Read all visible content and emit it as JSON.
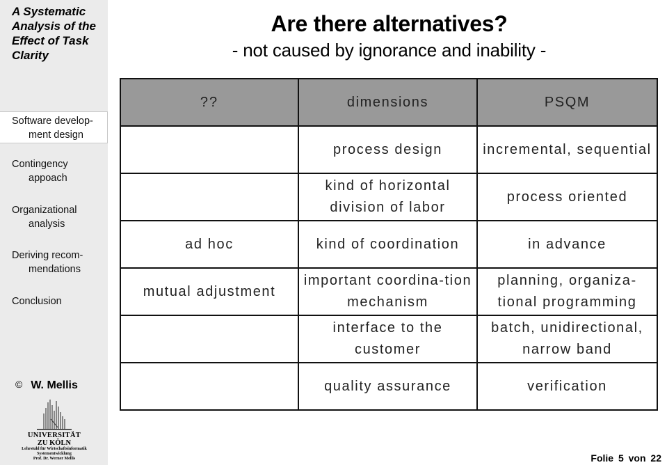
{
  "sidebar": {
    "deck_title": "A Systematic Analysis of the Effect of Task Clarity",
    "items": [
      {
        "line1": "Software develop-",
        "line2": "ment design",
        "active": true
      },
      {
        "line1": "Contingency",
        "line2": "appoach",
        "active": false
      },
      {
        "line1": "Organizational",
        "line2": "analysis",
        "active": false
      },
      {
        "line1": "Deriving recom-",
        "line2": "mendations",
        "active": false
      },
      {
        "line1": "Conclusion",
        "line2": "",
        "active": false
      }
    ],
    "copyright_symbol": "©",
    "author": "W. Mellis",
    "logo": {
      "line1": "UNIVERSITÄT",
      "line2": "ZU KÖLN",
      "line3": "Lehrstuhl für Wirtschaftsinformatik",
      "line4": "Systementwicklung",
      "line5": "Prof. Dr. Werner Mellis"
    }
  },
  "slide": {
    "title": "Are there alternatives?",
    "subtitle": "- not caused by ignorance and inability -",
    "table": {
      "headers": [
        "??",
        "dimensions",
        "PSQM"
      ],
      "rows": [
        [
          "",
          "process design",
          "incremental, sequential"
        ],
        [
          "",
          "kind of horizontal division of labor",
          "process oriented"
        ],
        [
          "ad hoc",
          "kind of coordination",
          "in advance"
        ],
        [
          "mutual adjustment",
          "important coordina-tion mechanism",
          "planning, organiza-tional programming"
        ],
        [
          "",
          "interface to the customer",
          "batch, unidirectional, narrow band"
        ],
        [
          "",
          "quality assurance",
          "verification"
        ]
      ]
    },
    "header_color": "#999999"
  },
  "footer": {
    "page_label": "Folie 5  von 22"
  }
}
